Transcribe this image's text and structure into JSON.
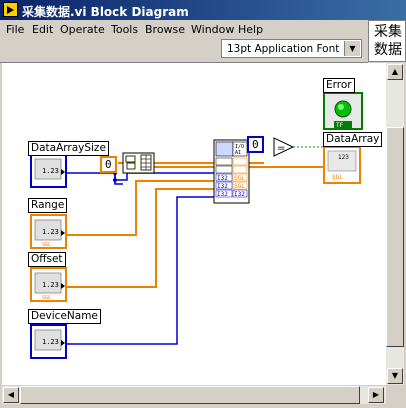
{
  "window": {
    "title": "采集数据.vi Block Diagram"
  },
  "menu": [
    "File",
    "Edit",
    "Operate",
    "Tools",
    "Browse",
    "Window",
    "Help"
  ],
  "toolbar": {
    "font_select": "13pt Application Font"
  },
  "side_panel": {
    "line1": "采集",
    "line2": "数据"
  },
  "diagram": {
    "controls": [
      {
        "label": "DataArraySize",
        "type": "1.23"
      },
      {
        "label": "Range",
        "type": "1.23",
        "subtype": "SGL"
      },
      {
        "label": "Offset",
        "type": "1.23",
        "subtype": "SGL"
      },
      {
        "label": "DeviceName",
        "type": "1.23"
      }
    ],
    "constant_zero_left": "0",
    "constant_zero_right": "0",
    "indicators": {
      "error": {
        "label": "Error",
        "subtype": "TF"
      },
      "data_array": {
        "label": "DataArray",
        "subtype": "SGL",
        "type": "123"
      }
    },
    "node_terms": {
      "i32": "I32",
      "sgl": "SGL"
    }
  },
  "colors": {
    "orange_wire": "#f08000",
    "blue_wire": "#0000cc",
    "green_led": "#00c000"
  }
}
